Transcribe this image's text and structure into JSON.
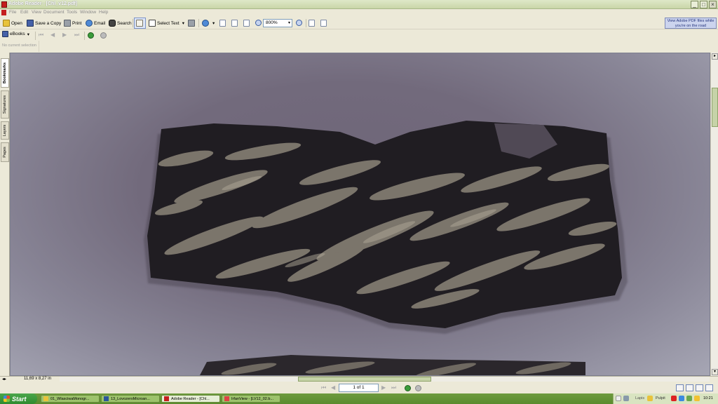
{
  "window": {
    "title": "Adobe Reader - [Chl_v12.pdf]",
    "buttons": [
      "_",
      "□",
      "×"
    ]
  },
  "menu": [
    "File",
    "Edit",
    "View",
    "Document",
    "Tools",
    "Window",
    "Help"
  ],
  "toolbar": {
    "open": "Open",
    "save_copy": "Save a Copy",
    "print": "Print",
    "email": "Email",
    "search": "Search",
    "select_text": "Select Text",
    "zoom_value": "800%",
    "ad_text": "View Adobe PDF files while you're on the road"
  },
  "toolbar2": {
    "ebooks": "eBooks"
  },
  "selection": {
    "text": "No current selection"
  },
  "side_tabs": [
    "Bookmarks",
    "Signatures",
    "Layers",
    "Pages"
  ],
  "status": {
    "page_dims": "11,69 x 8,27 in",
    "page_indicator": "1 of 1"
  },
  "taskbar": {
    "start": "Start",
    "tasks": [
      "01_WlasciwaMonogr...",
      "13_LovozeroMicroan...",
      "Adobe Reader - [Chl...",
      "IrfanView - [LV12_02.b..."
    ],
    "tray_lang": "Lapis",
    "tray_folder": "Pulpit",
    "clock": "10:21"
  },
  "colors": {
    "rock_dark": "#1c1a1e",
    "rock_light": "#8c8578",
    "background": "#6e6578"
  }
}
